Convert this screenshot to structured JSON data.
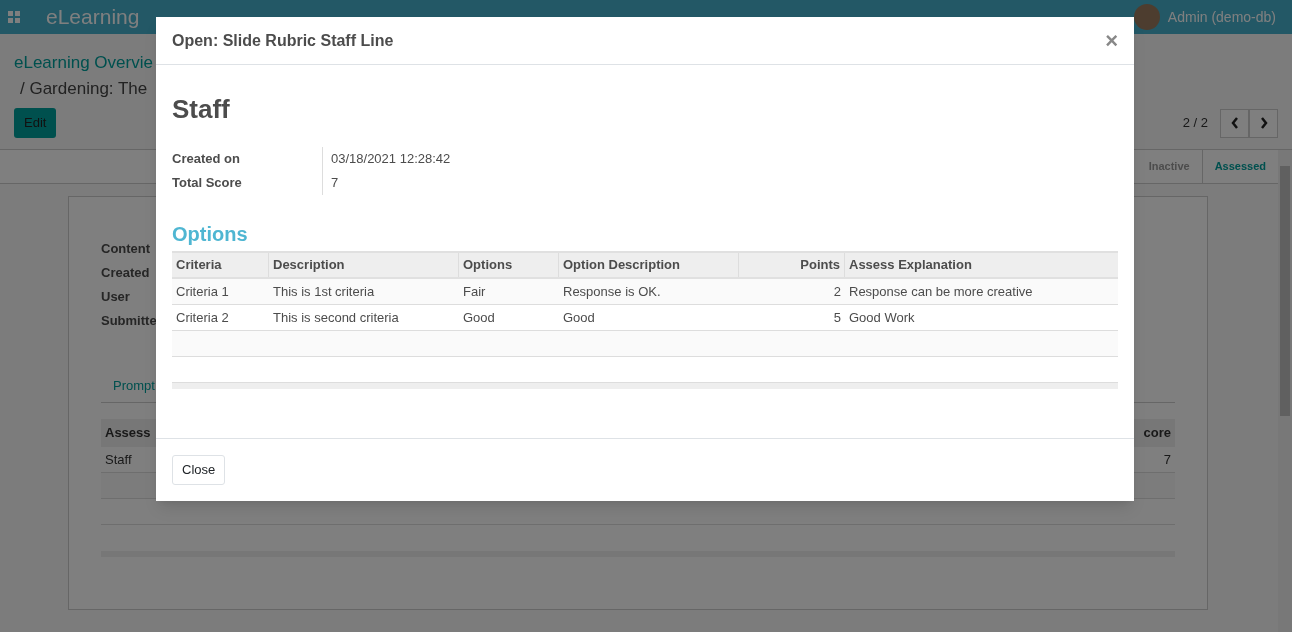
{
  "navbar": {
    "app_name": "eLearning",
    "user": "Admin (demo-db)"
  },
  "page": {
    "breadcrumb": "eLearning Overvie",
    "record_title": "/ Gardening: The",
    "edit_button": "Edit",
    "pager": "2 / 2",
    "stages": [
      {
        "label": "Inactive",
        "selected": false
      },
      {
        "label": "Assessed",
        "selected": true
      }
    ],
    "fields": [
      "Content",
      "Created",
      "User",
      "Submitte"
    ],
    "tab": "Prompt",
    "table": {
      "header_left": "Assess",
      "header_right": "core",
      "rows": [
        {
          "name": "Staff",
          "score": "7"
        }
      ]
    }
  },
  "dialog": {
    "title": "Open: Slide Rubric Staff Line",
    "close_icon": "×",
    "name": "Staff",
    "fields": [
      {
        "label": "Created on",
        "value": "03/18/2021 12:28:42"
      },
      {
        "label": "Total Score",
        "value": "7"
      }
    ],
    "section": "Options",
    "table": {
      "columns": [
        "Criteria",
        "Description",
        "Options",
        "Option Description",
        "Points",
        "Assess Explanation"
      ],
      "rows": [
        [
          "Criteria 1",
          "This is 1st criteria",
          "Fair",
          "Response is OK.",
          "2",
          "Response can be more creative"
        ],
        [
          "Criteria 2",
          "This is second criteria",
          "Good",
          "Good",
          "5",
          "Good Work"
        ]
      ]
    },
    "footer_button": "Close"
  }
}
